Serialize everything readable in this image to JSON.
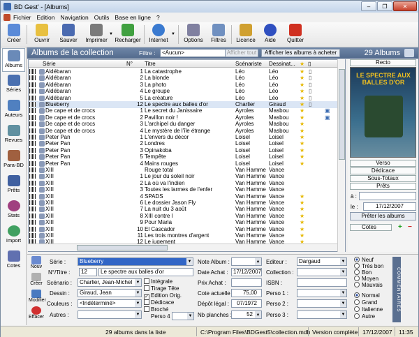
{
  "window": {
    "title": "BD Gest' - [Albums]",
    "min": "–",
    "max": "❐",
    "close": "✕"
  },
  "menu": [
    "Fichier",
    "Edition",
    "Navigation",
    "Outils",
    "Base en ligne",
    "?"
  ],
  "toolbar": [
    {
      "name": "creer",
      "label": "Créer",
      "color": "#5a8ad8"
    },
    {
      "name": "ouvrir",
      "label": "Ouvrir",
      "color": "#e8c040"
    },
    {
      "name": "sauver",
      "label": "Sauver",
      "color": "#4a6ab0"
    },
    {
      "name": "imprimer",
      "label": "Imprimer",
      "color": "#7a7a7a"
    },
    {
      "name": "recharger",
      "label": "Recharger",
      "color": "#40a040"
    },
    {
      "name": "internet",
      "label": "Internet",
      "color": "#3a7ad0"
    },
    {
      "name": "options",
      "label": "Options",
      "color": "#8080a0"
    },
    {
      "name": "filtres",
      "label": "Filtres",
      "color": "#7090c0"
    },
    {
      "name": "licence",
      "label": "Licence",
      "color": "#d0a030"
    },
    {
      "name": "aide",
      "label": "Aide",
      "color": "#3050c0"
    },
    {
      "name": "quitter",
      "label": "Quitter",
      "color": "#d03020"
    }
  ],
  "sidebar": [
    {
      "name": "albums",
      "label": "Albums",
      "color": "#6a8ab8"
    },
    {
      "name": "series",
      "label": "Séries",
      "color": "#4a70b0"
    },
    {
      "name": "auteurs",
      "label": "Auteurs",
      "color": "#5080c0"
    },
    {
      "name": "revues",
      "label": "Revues",
      "color": "#6090a0"
    },
    {
      "name": "para-bd",
      "label": "Para-BD",
      "color": "#a06040"
    },
    {
      "name": "prets",
      "label": "Prêts",
      "color": "#4060a0"
    },
    {
      "name": "stats",
      "label": "Stats",
      "color": "#a04080"
    },
    {
      "name": "import",
      "label": "Import",
      "color": "#40a060"
    },
    {
      "name": "cotes",
      "label": "Cotes",
      "color": "#6070b0"
    }
  ],
  "header": {
    "title": "Albums de la collection",
    "filter_label": "Filtre :",
    "filter_value": "<Aucun>",
    "show_all": "Afficher tout",
    "show_to_buy": "Afficher les albums à acheter",
    "count": "29 Albums"
  },
  "grid": {
    "columns": [
      "Série",
      "N°",
      "Titre",
      "Scénariste",
      "Dessinat..."
    ],
    "rows": [
      {
        "serie": "Aldébaran",
        "num": "1",
        "titre": "La catastrophe",
        "scen": "Léo",
        "dess": "Léo",
        "star": true,
        "doc": true,
        "card": false
      },
      {
        "serie": "Aldébaran",
        "num": "2",
        "titre": "La blonde",
        "scen": "Léo",
        "dess": "Léo",
        "star": true,
        "doc": true,
        "card": false
      },
      {
        "serie": "Aldébaran",
        "num": "3",
        "titre": "La photo",
        "scen": "Léo",
        "dess": "Léo",
        "star": true,
        "doc": true,
        "card": false
      },
      {
        "serie": "Aldébaran",
        "num": "4",
        "titre": "Le groupe",
        "scen": "Léo",
        "dess": "Léo",
        "star": true,
        "doc": true,
        "card": false
      },
      {
        "serie": "Aldébaran",
        "num": "5",
        "titre": "La créature",
        "scen": "Léo",
        "dess": "Léo",
        "star": true,
        "doc": true,
        "card": false
      },
      {
        "serie": "Blueberry",
        "num": "12",
        "titre": "Le spectre aux balles d'or",
        "scen": "Charlier",
        "dess": "Giraud",
        "star": true,
        "doc": true,
        "card": false
      },
      {
        "serie": "De cape et de crocs",
        "num": "1",
        "titre": "Le secret du Janissaire",
        "scen": "Ayroles",
        "dess": "Masbou",
        "star": true,
        "doc": false,
        "card": true
      },
      {
        "serie": "De cape et de crocs",
        "num": "2",
        "titre": "Pavillon noir !",
        "scen": "Ayroles",
        "dess": "Masbou",
        "star": true,
        "doc": false,
        "card": true
      },
      {
        "serie": "De cape et de crocs",
        "num": "3",
        "titre": "L'archipel du danger",
        "scen": "Ayroles",
        "dess": "Masbou",
        "star": true,
        "doc": false,
        "card": false
      },
      {
        "serie": "De cape et de crocs",
        "num": "4",
        "titre": "Le mystère de l'île étrange",
        "scen": "Ayroles",
        "dess": "Masbou",
        "star": true,
        "doc": false,
        "card": false
      },
      {
        "serie": "Peter Pan",
        "num": "1",
        "titre": "L'envers du décor",
        "scen": "Loisel",
        "dess": "Loisel",
        "star": true,
        "doc": false,
        "card": false
      },
      {
        "serie": "Peter Pan",
        "num": "2",
        "titre": "Londres",
        "scen": "Loisel",
        "dess": "Loisel",
        "star": true,
        "doc": false,
        "card": false
      },
      {
        "serie": "Peter Pan",
        "num": "3",
        "titre": "Opinakoba",
        "scen": "Loisel",
        "dess": "Loisel",
        "star": true,
        "doc": false,
        "card": false
      },
      {
        "serie": "Peter Pan",
        "num": "5",
        "titre": "Tempête",
        "scen": "Loisel",
        "dess": "Loisel",
        "star": true,
        "doc": false,
        "card": false
      },
      {
        "serie": "Peter Pan",
        "num": "4",
        "titre": "Mains rouges",
        "scen": "Loisel",
        "dess": "Loisel",
        "star": true,
        "doc": false,
        "card": false
      },
      {
        "serie": "XIII",
        "num": "",
        "titre": "Rouge total",
        "scen": "Van Hamme",
        "dess": "Vance",
        "star": false,
        "doc": false,
        "card": false
      },
      {
        "serie": "XIII",
        "num": "1",
        "titre": "Le jour du soleil noir",
        "scen": "Van Hamme",
        "dess": "Vance",
        "star": false,
        "doc": false,
        "card": false
      },
      {
        "serie": "XIII",
        "num": "2",
        "titre": "Là où va l'indien",
        "scen": "Van Hamme",
        "dess": "Vance",
        "star": false,
        "doc": false,
        "card": false
      },
      {
        "serie": "XIII",
        "num": "3",
        "titre": "Toutes les larmes de l'enfer",
        "scen": "Van Hamme",
        "dess": "Vance",
        "star": false,
        "doc": false,
        "card": false
      },
      {
        "serie": "XIII",
        "num": "4",
        "titre": "SPADS",
        "scen": "Van Hamme",
        "dess": "Vance",
        "star": true,
        "doc": false,
        "card": false
      },
      {
        "serie": "XIII",
        "num": "6",
        "titre": "Le dossier Jason Fly",
        "scen": "Van Hamme",
        "dess": "Vance",
        "star": true,
        "doc": false,
        "card": false
      },
      {
        "serie": "XIII",
        "num": "7",
        "titre": "La nuit du 3 août",
        "scen": "Van Hamme",
        "dess": "Vance",
        "star": true,
        "doc": false,
        "card": false
      },
      {
        "serie": "XIII",
        "num": "8",
        "titre": "XIII contre l",
        "scen": "Van Hamme",
        "dess": "Vance",
        "star": true,
        "doc": false,
        "card": false
      },
      {
        "serie": "XIII",
        "num": "9",
        "titre": "Pour Maria",
        "scen": "Van Hamme",
        "dess": "Vance",
        "star": true,
        "doc": false,
        "card": false
      },
      {
        "serie": "XIII",
        "num": "10",
        "titre": "El Cascador",
        "scen": "Van Hamme",
        "dess": "Vance",
        "star": true,
        "doc": false,
        "card": false
      },
      {
        "serie": "XIII",
        "num": "11",
        "titre": "Les trois montres d'argent",
        "scen": "Van Hamme",
        "dess": "Vance",
        "star": true,
        "doc": false,
        "card": false
      },
      {
        "serie": "XIII",
        "num": "12",
        "titre": "Le jugement",
        "scen": "Van Hamme",
        "dess": "Vance",
        "star": true,
        "doc": false,
        "card": false
      }
    ]
  },
  "right_panel": {
    "recto": "Recto",
    "cover_text": "LE SPECTRE AUX BALLES D'OR",
    "verso": "Verso",
    "dedicace": "Dédicace",
    "sous_totaux": "Sous-Totaux",
    "prets": "Prêts",
    "a_label": "à :",
    "le_label": "le :",
    "le_value": "17/12/2007",
    "preter": "Prêter les albums",
    "cotes": "Cotes",
    "plus": "+",
    "minus": "−"
  },
  "form_tools": [
    {
      "name": "nouveau",
      "label": "Nouv",
      "color": "#6a8ad0"
    },
    {
      "name": "creer",
      "label": "Créer",
      "color": "#b0b0b0"
    },
    {
      "name": "modifier",
      "label": "Modifier",
      "color": "#4a7ac0"
    },
    {
      "name": "effacer",
      "label": "Effacer",
      "color": "#d03030"
    }
  ],
  "form": {
    "serie_label": "Série :",
    "serie_value": "Blueberry",
    "numtitre_label": "N°/Titre :",
    "num_value": "12",
    "titre_value": "Le spectre aux balles d'or",
    "scenario_label": "Scénario :",
    "scenario_value": "Charlier, Jean-Michel",
    "dessin_label": "Dessin :",
    "dessin_value": "Giraud, Jean",
    "couleurs_label": "Couleurs :",
    "couleurs_value": "<Indéterminé>",
    "autres_label": "Autres :",
    "integrale": "Intégrale",
    "tirage_tete": "Tirage Tête",
    "edition_orig": "Edition Orig.",
    "dedicace": "Dédicace",
    "broche": "Broché",
    "perso4_label": "Perso 4 :",
    "note_label": "Note Album :",
    "date_achat_label": "Date Achat :",
    "date_achat_value": "17/12/2007",
    "prix_label": "Prix Achat :",
    "cote_label": "Cote actuelle :",
    "cote_value": "75,00",
    "depot_label": "Dépôt légal :",
    "depot_value": "07/1972",
    "planches_label": "Nb planches :",
    "planches_value": "52",
    "editeur_label": "Editeur :",
    "editeur_value": "Dargaud",
    "collection_label": "Collection :",
    "isbn_label": "ISBN :",
    "perso1_label": "Perso 1 :",
    "perso2_label": "Perso 2 :",
    "perso3_label": "Perso 3 :",
    "etat": [
      "Neuf",
      "Très bon",
      "Bon",
      "Moyen",
      "Mauvais"
    ],
    "etat_selected": 0,
    "rarete": [
      "Normal",
      "Grand",
      "Italienne",
      "Autre"
    ],
    "rarete_selected": 0,
    "commentaires": "COMMENTAIRES"
  },
  "status": {
    "count": "29 albums dans la liste",
    "path": "C:\\Program Files\\BDGest5\\collection.mdb",
    "version": "Version complète",
    "date": "17/12/2007",
    "time": "11:35"
  }
}
